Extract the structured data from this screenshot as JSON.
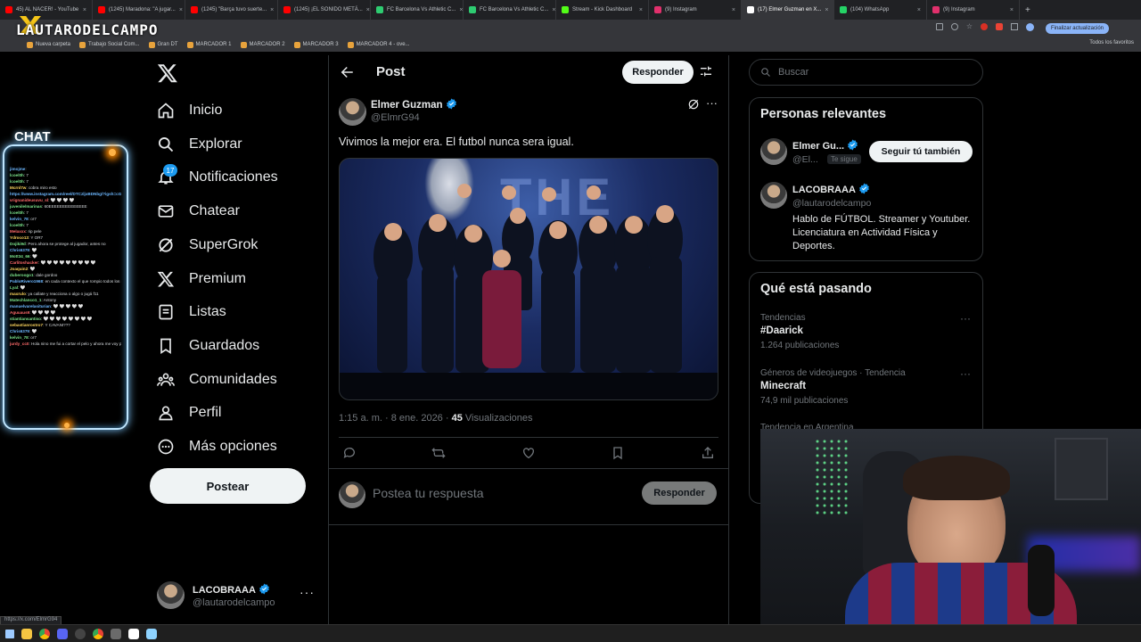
{
  "browser": {
    "tabs": [
      {
        "label": "45) AL NACER! - YouTube",
        "color": "#ff0000"
      },
      {
        "label": "(1245) Maradona: \"A jugar...",
        "color": "#ff0000"
      },
      {
        "label": "(1245) \"Barça tuvo suerte...",
        "color": "#ff0000"
      },
      {
        "label": "(1245) ¡EL SONIDO METÁ...",
        "color": "#ff0000"
      },
      {
        "label": "FC Barcelona Vs Athletic C...",
        "color": "#2ecc71"
      },
      {
        "label": "FC Barcelona Vs Athletic C...",
        "color": "#2ecc71"
      },
      {
        "label": "Stream - Kick Dashboard",
        "color": "#53fc18"
      },
      {
        "label": "(9) Instagram",
        "color": "#e1306c"
      },
      {
        "label": "(17) Elmer Guzman en X...",
        "color": "#ffffff",
        "active": true
      },
      {
        "label": "(104) WhatsApp",
        "color": "#25d366"
      },
      {
        "label": "(9) Instagram",
        "color": "#e1306c"
      }
    ],
    "update_label": "Finalizar actualización",
    "bookmarks": [
      "Nueva carpeta",
      "Trabajo Social Com...",
      "Gran DT",
      "MARCADOR 1",
      "MARCADOR 2",
      "MARCADOR 3",
      "MARCADOR 4 - ove..."
    ],
    "all_bookmarks": "Todos los favoritos",
    "status_url": "https://x.com/ElmrG94"
  },
  "overlay": {
    "brand": "LAUTARODELCAMPO",
    "chat_title": "CHAT",
    "chat_lines": [
      {
        "user": "jimojme",
        "text": ": ",
        "cls": "b"
      },
      {
        "user": "lcoel0h",
        "text": ": 7",
        "cls": ""
      },
      {
        "user": "lcoel0h",
        "text": ": 7",
        "cls": ""
      },
      {
        "user": "Mcrnl7w",
        "text": ": cobra miro esto",
        "cls": "y"
      },
      {
        "user": "https://www.instagram.com/reel/DTCzljxBDNbg/?igsh=cGdlcjhrcnpjbHRz",
        "text": "",
        "cls": "b"
      },
      {
        "user": "vrignanideusuvu_sl",
        "text": ": 🤍 🤍 🤍 🤍",
        "cls": "r"
      },
      {
        "user": "juvenilelmarinas",
        "text": ": 60EEEEEEEEEEEEEE",
        "cls": ""
      },
      {
        "user": "lcoel0h",
        "text": ": 7",
        "cls": ""
      },
      {
        "user": "kelvin_78",
        "text": ": or7",
        "cls": "b"
      },
      {
        "user": "lcoel0h",
        "text": ": 7",
        "cls": ""
      },
      {
        "user": "Melaxxx",
        "text": ": rip pele",
        "cls": "r"
      },
      {
        "user": "Ydroco13",
        "text": ": Y OR7",
        "cls": "y"
      },
      {
        "user": "Dojiki9d",
        "text": ": Pero ahora se protege al jugador, antes no",
        "cls": ""
      },
      {
        "user": "Chris6379",
        "text": ": 🤍",
        "cls": "b"
      },
      {
        "user": "Mott34_66",
        "text": ": 🤍",
        "cls": ""
      },
      {
        "user": "Carlitoshacker",
        "text": ": 🤍 🤍 🤍 🤍 🤍 🤍 🤍 🤍 🤍",
        "cls": "r"
      },
      {
        "user": "Joaquin2",
        "text": ": 🤍",
        "cls": "y"
      },
      {
        "user": "duberoogo1",
        "text": ": dale gordoo",
        "cls": ""
      },
      {
        "user": "PabloRivero1968",
        "text": ": en cada contexto el que rompio todos los records es MESSI",
        "cls": "b"
      },
      {
        "user": "Lyal",
        "text": ": 🤍",
        "cls": ""
      },
      {
        "user": "maxrulo",
        "text": ": ya callate y reacciona o algo o jugá f11",
        "cls": "y"
      },
      {
        "user": "Matechlanco1_1",
        "text": ": Antony",
        "cls": ""
      },
      {
        "user": "manuelvarelasiturian",
        "text": ": 🤍 🤍 🤍 🤍 🤍",
        "cls": "b"
      },
      {
        "user": "Aguuaus9",
        "text": ": 🤍 🤍 🤍 🤍",
        "cls": "r"
      },
      {
        "user": "stiantiansantiso",
        "text": ": 🤍 🤍 🤍 🤍 🤍 🤍 🤍 🤍",
        "cls": ""
      },
      {
        "user": "sebastianrostro7",
        "text": ": Y CAVANI???",
        "cls": "y"
      },
      {
        "user": "Chris6379",
        "text": ": 🤍",
        "cls": "b"
      },
      {
        "user": "kelvin_78",
        "text": ": or7",
        "cls": ""
      },
      {
        "user": "jurdy_cc0",
        "text": ": Hola nino me fui a cortar el pelo y ahora me voy para que vea 🤍 🤍 🤍",
        "cls": "r"
      }
    ]
  },
  "nav": {
    "items": [
      {
        "label": "Inicio",
        "icon": "home-icon"
      },
      {
        "label": "Explorar",
        "icon": "search-icon"
      },
      {
        "label": "Notificaciones",
        "icon": "bell-icon"
      },
      {
        "label": "Chatear",
        "icon": "mail-icon"
      },
      {
        "label": "SuperGrok",
        "icon": "grok-icon"
      },
      {
        "label": "Premium",
        "icon": "x-logo-icon"
      },
      {
        "label": "Listas",
        "icon": "list-icon"
      },
      {
        "label": "Guardados",
        "icon": "bookmark-icon"
      },
      {
        "label": "Comunidades",
        "icon": "people-icon"
      },
      {
        "label": "Perfil",
        "icon": "person-icon"
      },
      {
        "label": "Más opciones",
        "icon": "more-circle-icon"
      }
    ],
    "notif_count": "17",
    "post_label": "Postear",
    "account": {
      "name": "LACOBRAAA",
      "handle": "@lautarodelcampo"
    }
  },
  "post": {
    "header_title": "Post",
    "reply_button": "Responder",
    "author_name": "Elmer Guzman",
    "author_handle": "@ElmrG94",
    "text": "Vivimos la mejor era. El futbol nunca sera igual.",
    "image_stage_text": "THE",
    "timestamp": "1:15 a. m. · 8 ene. 2026 ·",
    "views_count": "45",
    "views_label": "Visualizaciones",
    "reply_placeholder": "Postea tu respuesta",
    "reply_submit": "Responder"
  },
  "sidebar": {
    "search_placeholder": "Buscar",
    "relevant_title": "Personas relevantes",
    "people": [
      {
        "name": "Elmer Gu...",
        "handle": "@El...",
        "follows_you": "Te sigue",
        "follow_button": "Seguir tú también"
      },
      {
        "name": "LACOBRAAA",
        "handle": "@lautarodelcampo",
        "bio": "Hablo de FÚTBOL. Streamer y Youtuber. Licenciatura en Actividad Física y Deportes."
      }
    ],
    "trending_title": "Qué está pasando",
    "trends": [
      {
        "context": "Tendencias",
        "name": "#Daarick",
        "count": "1.264 publicaciones"
      },
      {
        "context": "Géneros de videojuegos · Tendencia",
        "name": "Minecraft",
        "count": "74,9 mil publicaciones"
      },
      {
        "context": "Tendencia en Argentina",
        "name": "",
        "count": ""
      }
    ]
  },
  "colors": {
    "accent": "#1d9bf0",
    "background": "#000000",
    "border": "#2f3336",
    "muted": "#71767b"
  }
}
